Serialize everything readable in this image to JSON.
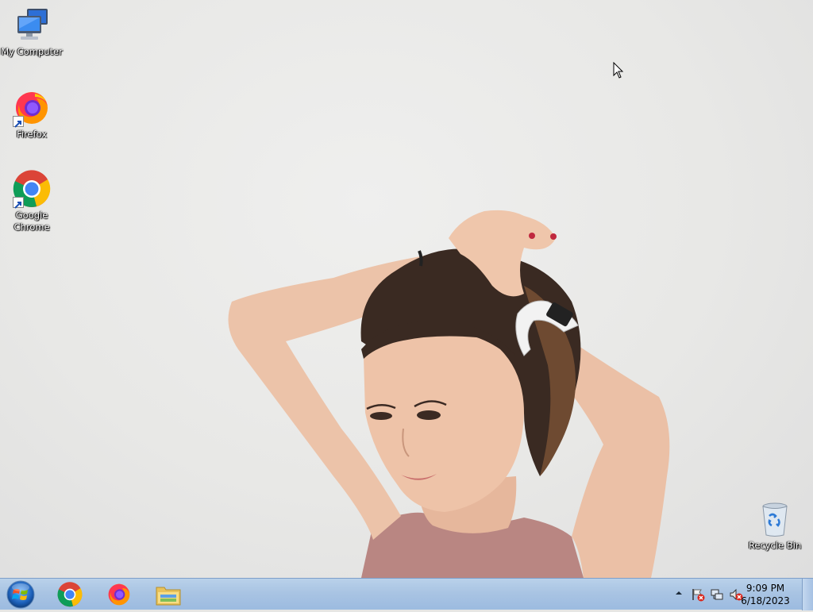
{
  "desktop": {
    "icons": [
      {
        "label": "My Computer",
        "icon": "computer-icon"
      },
      {
        "label": "Firefox",
        "icon": "firefox-icon"
      },
      {
        "label": "Google Chrome",
        "icon": "chrome-icon"
      },
      {
        "label": "Recycle Bin",
        "icon": "recycle-bin-icon"
      }
    ]
  },
  "taskbar": {
    "start": {
      "icon": "windows-logo-icon"
    },
    "pinned": [
      {
        "icon": "chrome-icon"
      },
      {
        "icon": "firefox-icon"
      },
      {
        "icon": "file-explorer-icon"
      }
    ],
    "tray": {
      "icons": [
        "show-hidden-icons-chevron",
        "action-center-flag-icon",
        "network-icon",
        "volume-muted-icon"
      ],
      "time": "9:09 PM",
      "date": "6/18/2023"
    }
  },
  "colors": {
    "taskbar_top": "#b9d1ea",
    "taskbar_bottom": "#9cbbe0",
    "wallpaper": "#e8e8e6"
  }
}
